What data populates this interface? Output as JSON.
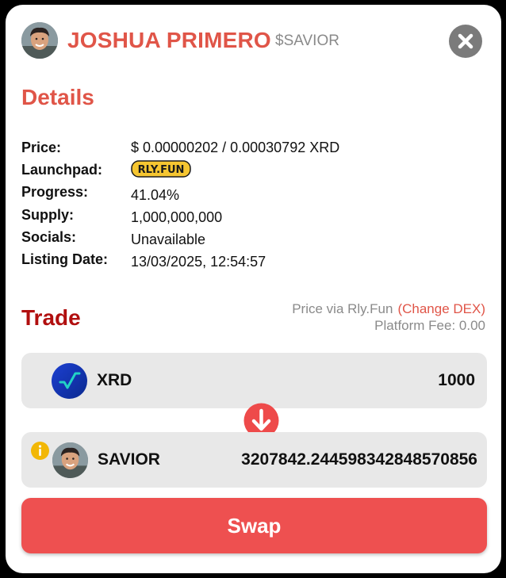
{
  "header": {
    "name": "JOSHUA PRIMERO",
    "ticker": "$SAVIOR",
    "avatar_icon": "avatar-photo",
    "close_icon": "close-icon"
  },
  "details": {
    "title": "Details",
    "rows": [
      {
        "label": "Price:",
        "value": "$ 0.00000202 / 0.00030792 XRD"
      },
      {
        "label": "Launchpad:",
        "value": "RLY.FUN"
      },
      {
        "label": "Progress:",
        "value": "41.04%"
      },
      {
        "label": "Supply:",
        "value": "1,000,000,000"
      },
      {
        "label": "Socials:",
        "value": "Unavailable"
      },
      {
        "label": "Listing Date:",
        "value": "13/03/2025, 12:54:57"
      }
    ]
  },
  "trade": {
    "title": "Trade",
    "price_via": "Price via Rly.Fun",
    "change_dex": "(Change DEX)",
    "platform_fee": "Platform Fee: 0.00",
    "from": {
      "token": "XRD",
      "amount": "1000",
      "icon": "xrd-logo-icon"
    },
    "to": {
      "token": "SAVIOR",
      "amount": "3207842.244598342848570856",
      "icon": "savior-avatar-icon"
    },
    "swap_label": "Swap"
  },
  "colors": {
    "accent": "#e05548",
    "trade_title": "#b10f0f",
    "swap_button": "#ee5050",
    "token_box": "#e8e8e8",
    "info_icon": "#f2b705",
    "xrd_logo": "#1e4fd6"
  }
}
